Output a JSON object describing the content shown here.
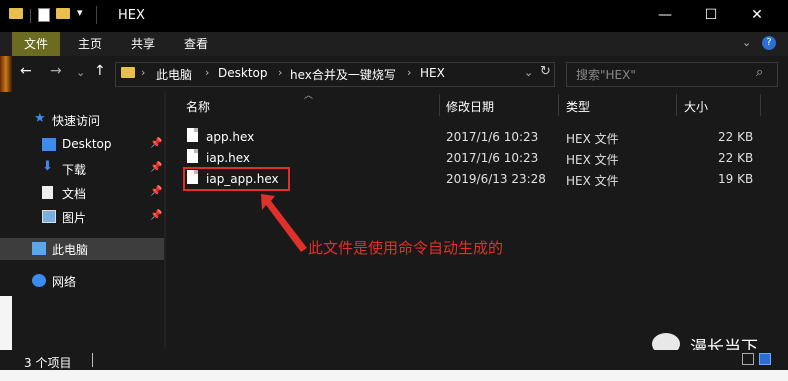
{
  "window": {
    "title": "HEX",
    "controls": {
      "minimize": "—",
      "maximize": "☐",
      "close": "✕"
    }
  },
  "ribbon": {
    "tabs": [
      "文件",
      "主页",
      "共享",
      "查看"
    ],
    "expand_glyph": "⌄",
    "help_glyph": "?"
  },
  "nav_buttons": {
    "back": "←",
    "forward": "→",
    "recent": "⌄",
    "up": "↑"
  },
  "address": {
    "crumbs": [
      "此电脑",
      "Desktop",
      "hex合并及一键烧写",
      "HEX"
    ],
    "separator": "›",
    "dropdown": "⌄",
    "refresh": "↻"
  },
  "search": {
    "placeholder": "搜索\"HEX\"",
    "icon": "search-icon"
  },
  "nav_pane": {
    "quick_access": "快速访问",
    "items": [
      {
        "label": "Desktop",
        "icon": "desktop-icon",
        "pinned": true
      },
      {
        "label": "下载",
        "icon": "download-icon",
        "pinned": true
      },
      {
        "label": "文档",
        "icon": "document-icon",
        "pinned": true
      },
      {
        "label": "图片",
        "icon": "picture-icon",
        "pinned": true
      }
    ],
    "this_pc": "此电脑",
    "network": "网络"
  },
  "columns": {
    "name": "名称",
    "date": "修改日期",
    "type": "类型",
    "size": "大小"
  },
  "files": [
    {
      "name": "app.hex",
      "date": "2017/1/6 10:23",
      "type": "HEX 文件",
      "size": "22 KB"
    },
    {
      "name": "iap.hex",
      "date": "2017/1/6 10:23",
      "type": "HEX 文件",
      "size": "22 KB"
    },
    {
      "name": "iap_app.hex",
      "date": "2019/6/13 23:28",
      "type": "HEX 文件",
      "size": "19 KB"
    }
  ],
  "annotation": "此文件是使用命令自动生成的",
  "status": {
    "count": "3 个项目"
  },
  "watermark": "漫长当下",
  "colors": {
    "accent_tab": "#6b6b22",
    "annotation": "#e0302a",
    "folder": "#e8bf4a"
  }
}
